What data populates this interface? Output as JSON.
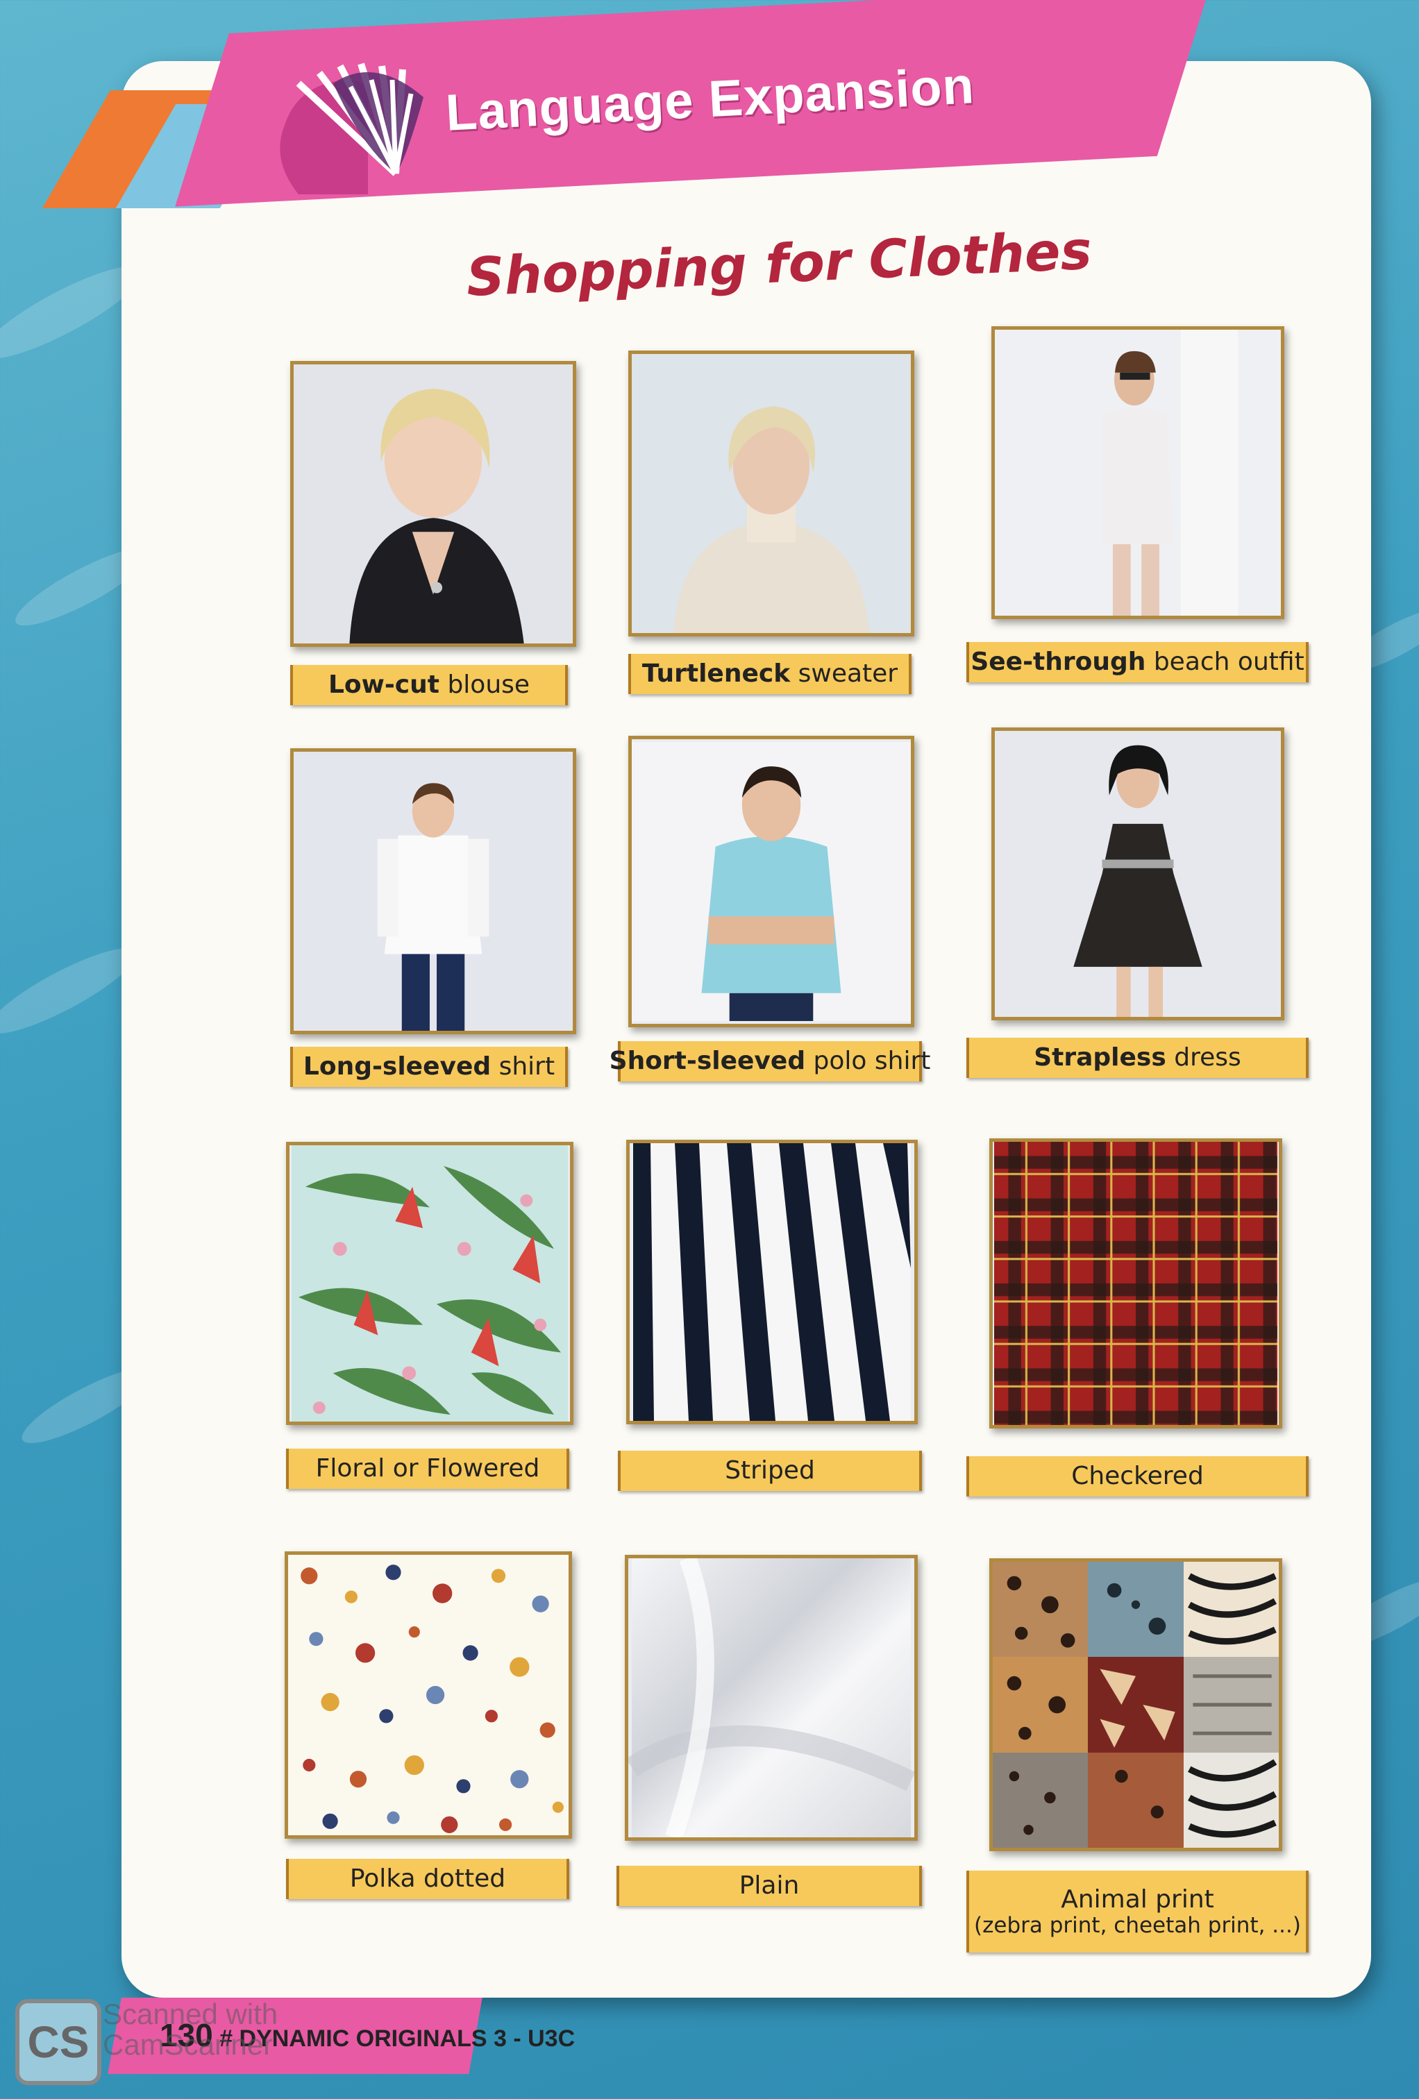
{
  "header": {
    "title": "Language Expansion"
  },
  "page_title": "Shopping for Clothes",
  "items": [
    {
      "bold": "Low-cut",
      "rest": " blouse"
    },
    {
      "bold": "Turtleneck",
      "rest": " sweater"
    },
    {
      "bold": "See-through",
      "rest": " beach outfit"
    },
    {
      "bold": "Long-sleeved",
      "rest": " shirt"
    },
    {
      "bold": "Short-sleeved",
      "rest": " polo shirt"
    },
    {
      "bold": "Strapless",
      "rest": " dress"
    },
    {
      "bold": "",
      "rest": "Floral or Flowered"
    },
    {
      "bold": "",
      "rest": "Striped"
    },
    {
      "bold": "",
      "rest": "Checkered"
    },
    {
      "bold": "",
      "rest": "Polka dotted"
    },
    {
      "bold": "",
      "rest": "Plain"
    },
    {
      "bold": "",
      "rest": "Animal print",
      "sub": "(zebra print, cheetah print, ...)"
    }
  ],
  "footer": {
    "page_number": "130",
    "series": "# DYNAMIC ORIGINALS 3 - U3C"
  },
  "scanner_watermark": {
    "logo": "CS",
    "text_line1": "Scanned with",
    "text_line2": "CamScanner"
  },
  "colors": {
    "header_pink": "#e85aa4",
    "title_red": "#b3263d",
    "label_gold": "#f7c95a",
    "background_blue": "#3d9ec0"
  }
}
